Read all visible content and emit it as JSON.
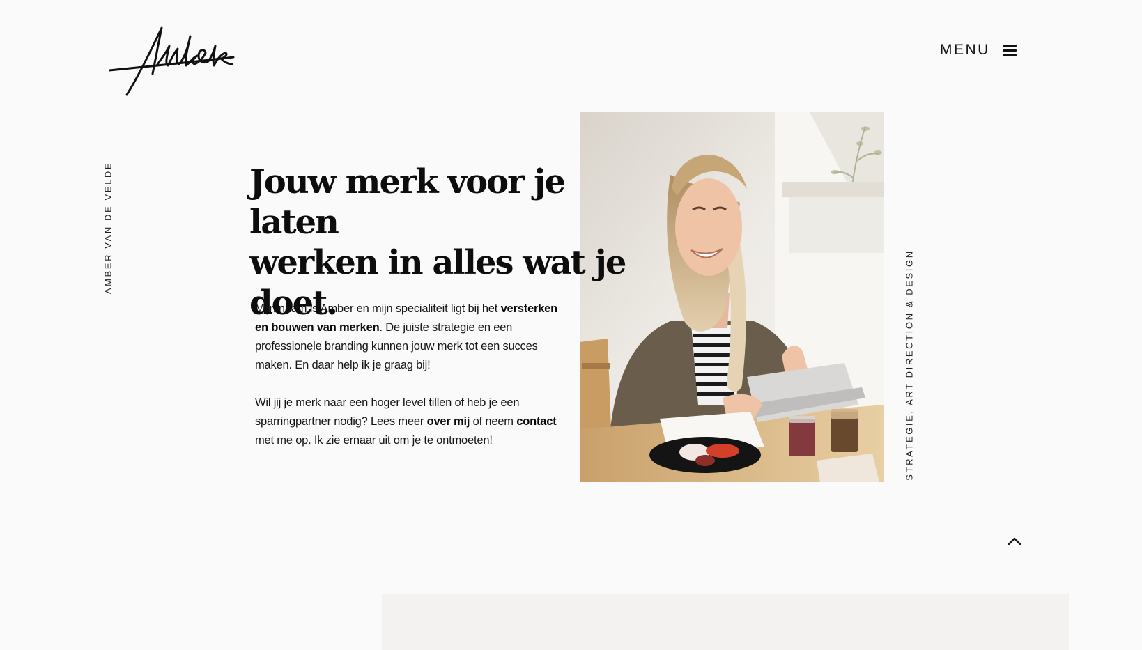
{
  "header": {
    "logo_text": "Amber",
    "menu_label": "MENU",
    "menu_icon": "hamburger-icon"
  },
  "sidebar_left": {
    "text": "AMBER VAN DE VELDE"
  },
  "sidebar_right": {
    "text": "STRATEGIE, ART DIRECTION & DESIGN"
  },
  "hero": {
    "headline_line1": "Jouw merk voor je laten",
    "headline_line2": "werken in alles wat je",
    "headline_line3": "doet.",
    "paragraph1": {
      "part1": "Mijn naam is Amber en mijn specialiteit ligt bij het ",
      "bold": "versterken en bouwen van merken",
      "part2": ". De juiste strategie en een professionele branding kunnen jouw merk tot een succes maken. En daar help ik je graag bij!"
    },
    "paragraph2": {
      "part1": "Wil jij je merk naar een hoger level tillen of heb je een sparringpartner nodig? Lees meer ",
      "link_about": "over mij",
      "part2": " of neem ",
      "link_contact": "contact",
      "part3": " met me op. Ik zie ernaar uit om je te ontmoeten!"
    },
    "photo_icon": "portrait-photo"
  },
  "footer": {
    "back_to_top_icon": "chevron-up-icon"
  },
  "colors": {
    "background": "#fafafa",
    "text": "#111111",
    "panel": "#f3f2f0"
  }
}
